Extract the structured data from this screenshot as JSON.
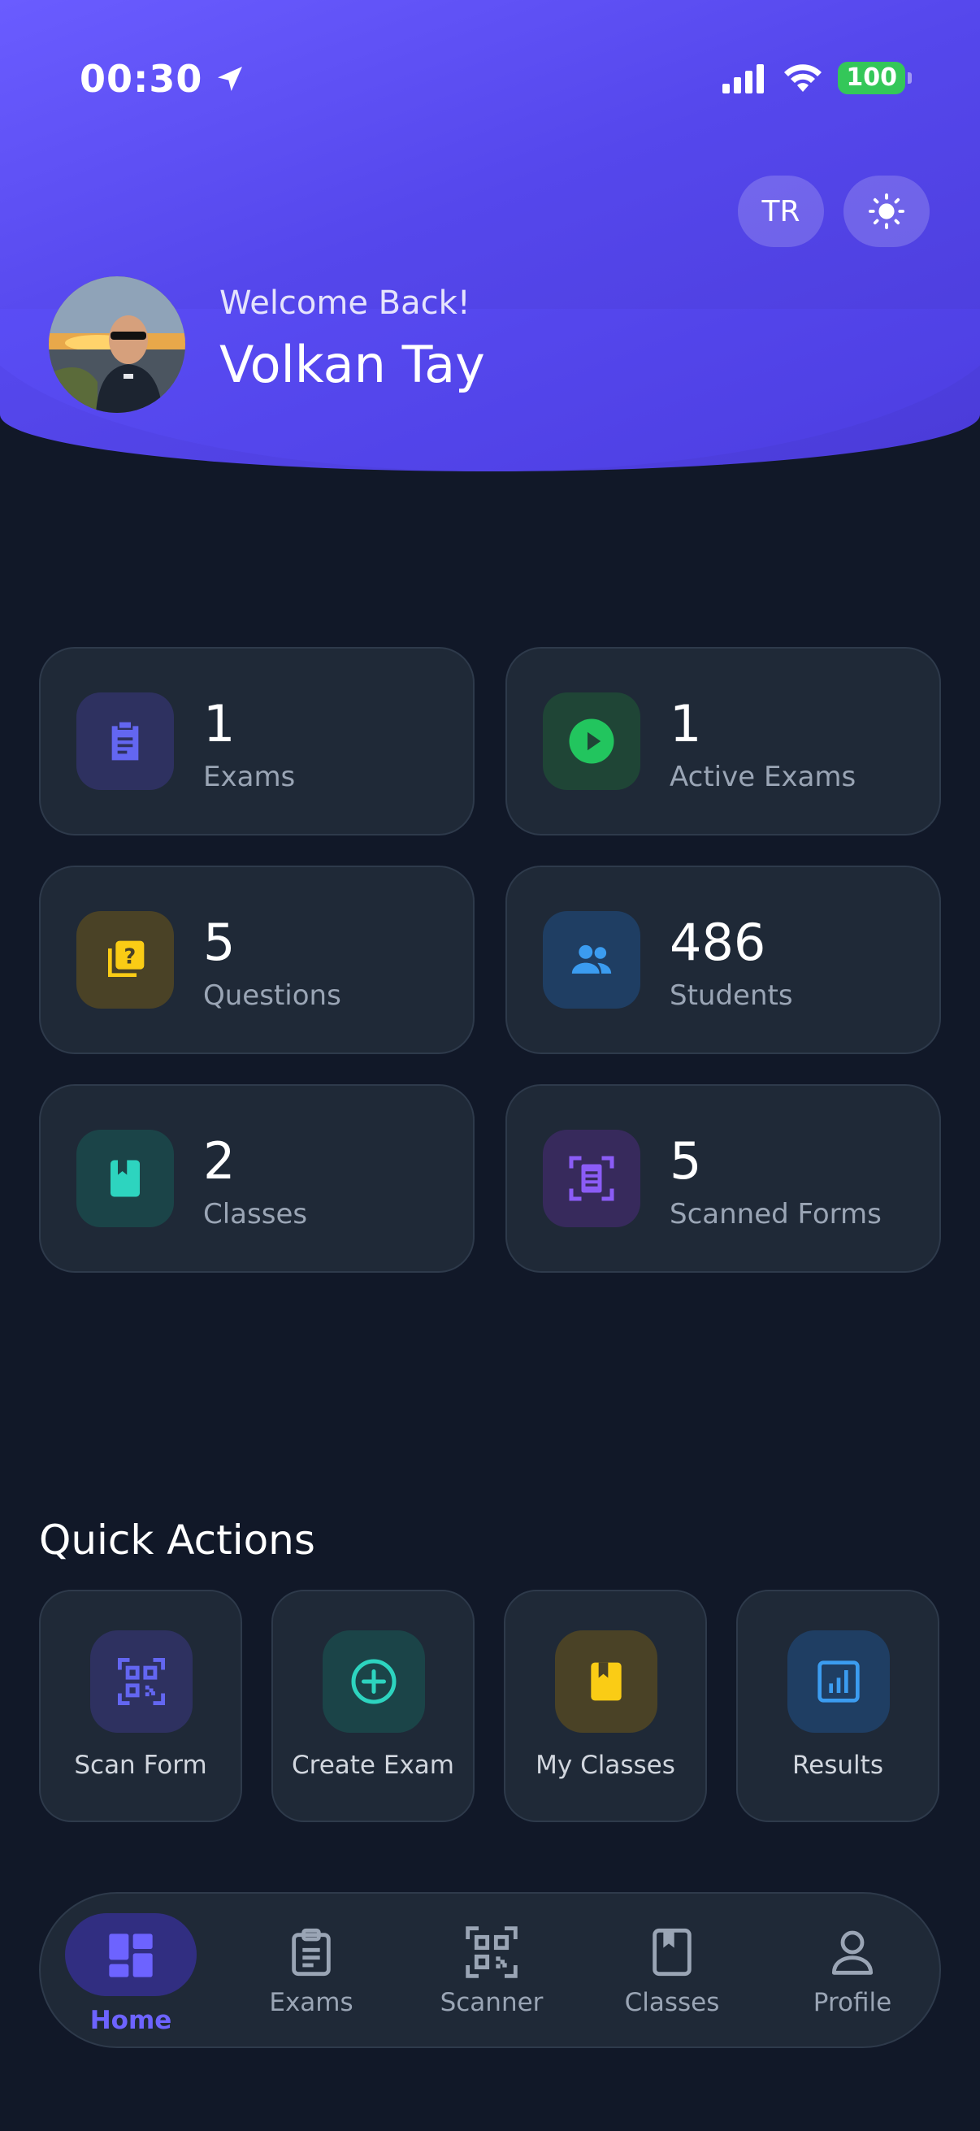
{
  "status_bar": {
    "time": "00:30",
    "battery": "100"
  },
  "header": {
    "language_button": "TR",
    "welcome": "Welcome Back!",
    "user_name": "Volkan Tay"
  },
  "stats": [
    {
      "value": "1",
      "label": "Exams",
      "icon": "clipboard-icon",
      "color": "#6366f1",
      "bg": "#2e3160"
    },
    {
      "value": "1",
      "label": "Active Exams",
      "icon": "play-circle-icon",
      "color": "#22c55e",
      "bg": "#1f4536"
    },
    {
      "value": "5",
      "label": "Questions",
      "icon": "question-stack-icon",
      "color": "#facc15",
      "bg": "#4a4226"
    },
    {
      "value": "486",
      "label": "Students",
      "icon": "people-icon",
      "color": "#3b9cf0",
      "bg": "#1f3e63"
    },
    {
      "value": "2",
      "label": "Classes",
      "icon": "book-icon",
      "color": "#2dd4bf",
      "bg": "#1b4448"
    },
    {
      "value": "5",
      "label": "Scanned Forms",
      "icon": "document-scan-icon",
      "color": "#8b5cf6",
      "bg": "#372a5c"
    }
  ],
  "quick_actions": {
    "title": "Quick Actions",
    "items": [
      {
        "label": "Scan Form",
        "icon": "qr-scan-icon",
        "color": "#6366f1",
        "bg": "#2e3160"
      },
      {
        "label": "Create Exam",
        "icon": "plus-circle-icon",
        "color": "#2dd4bf",
        "bg": "#1b4448"
      },
      {
        "label": "My Classes",
        "icon": "book-icon",
        "color": "#facc15",
        "bg": "#4a4226"
      },
      {
        "label": "Results",
        "icon": "chart-icon",
        "color": "#3b9cf0",
        "bg": "#1f3e63"
      }
    ]
  },
  "nav": {
    "items": [
      {
        "label": "Home",
        "icon": "dashboard-icon",
        "active": true
      },
      {
        "label": "Exams",
        "icon": "clipboard-icon",
        "active": false
      },
      {
        "label": "Scanner",
        "icon": "qr-scan-icon",
        "active": false
      },
      {
        "label": "Classes",
        "icon": "book-icon",
        "active": false
      },
      {
        "label": "Profile",
        "icon": "person-icon",
        "active": false
      }
    ]
  },
  "colors": {
    "background": "#111828",
    "card": "#1f2937",
    "accent": "#6d63ff",
    "header_start": "#6a5cff",
    "header_end": "#4a3bd8"
  }
}
